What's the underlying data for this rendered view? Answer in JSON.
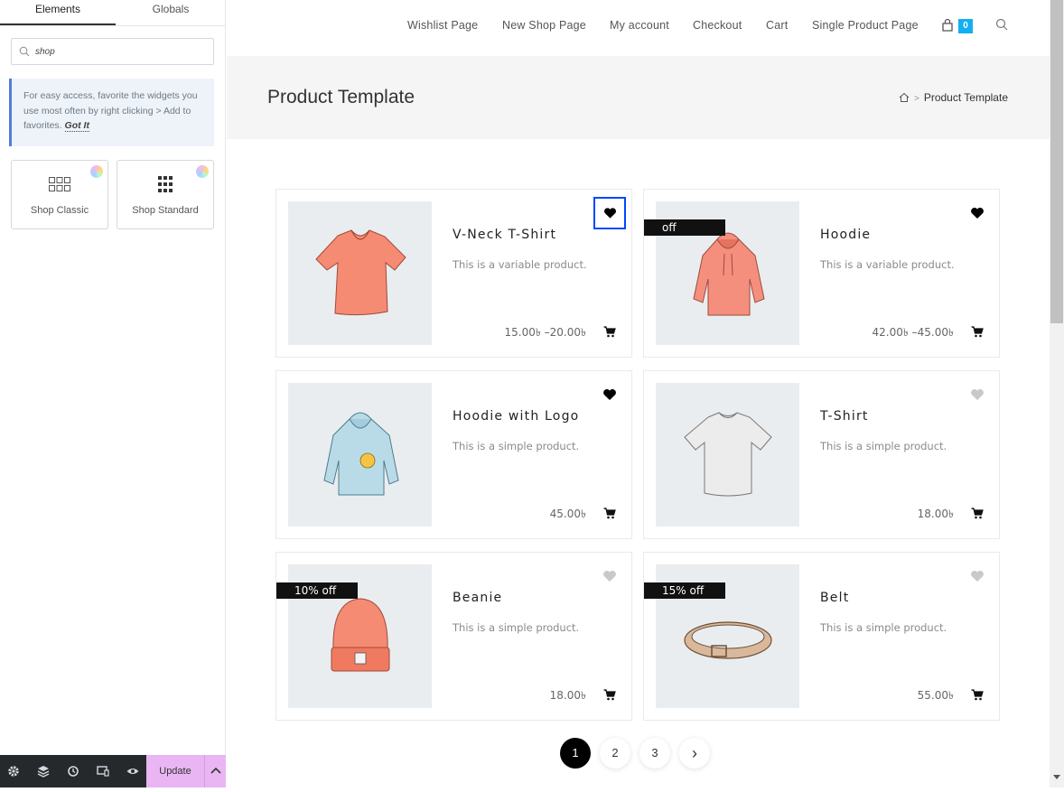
{
  "panel": {
    "tabs": [
      "Elements",
      "Globals"
    ],
    "search": {
      "value": "shop",
      "placeholder": ""
    },
    "tip": {
      "text": "For easy access, favorite the widgets you use most often by right clicking > Add to favorites.",
      "link": "Got It"
    },
    "widgets": [
      {
        "label": "Shop Classic",
        "icon": "shop-classic-grid-icon"
      },
      {
        "label": "Shop Standard",
        "icon": "shop-standard-grid-icon"
      }
    ],
    "footer": {
      "icons": [
        "settings-icon",
        "layers-icon",
        "history-icon",
        "responsive-icon",
        "preview-eye-icon"
      ],
      "update_label": "Update",
      "collapse_glyph": "‹"
    }
  },
  "site": {
    "nav": [
      "Wishlist Page",
      "New Shop Page",
      "My account",
      "Checkout",
      "Cart",
      "Single Product Page"
    ],
    "cart_count": "0",
    "page_title": "Product Template",
    "breadcrumb": {
      "separator": ">",
      "current": "Product Template"
    },
    "products": [
      {
        "title": "V-Neck T-Shirt",
        "desc": "This is a variable product.",
        "price": "15.00৳ –20.00৳",
        "badge": "",
        "wishlisted": true,
        "image": "vneck-tshirt"
      },
      {
        "title": "Hoodie",
        "desc": "This is a variable product.",
        "price": "42.00৳ –45.00৳",
        "badge": "off",
        "wishlisted": true,
        "image": "hoodie"
      },
      {
        "title": "Hoodie with Logo",
        "desc": "This is a simple product.",
        "price": "45.00৳",
        "badge": "",
        "wishlisted": true,
        "image": "hoodie-logo"
      },
      {
        "title": "T-Shirt",
        "desc": "This is a simple product.",
        "price": "18.00৳",
        "badge": "",
        "wishlisted": false,
        "image": "tshirt"
      },
      {
        "title": "Beanie",
        "desc": "This is a simple product.",
        "price": "18.00৳",
        "badge": "10% off",
        "wishlisted": false,
        "image": "beanie"
      },
      {
        "title": "Belt",
        "desc": "This is a simple product.",
        "price": "55.00৳",
        "badge": "15% off",
        "wishlisted": false,
        "image": "belt"
      }
    ],
    "pagination": [
      "1",
      "2",
      "3"
    ],
    "current_page": "1",
    "next_glyph": "›"
  },
  "colors": {
    "accent": "#13aff0",
    "selection": "#0047ff",
    "update_button": "#e9b6f3",
    "tip_border": "#4f7fd8"
  }
}
